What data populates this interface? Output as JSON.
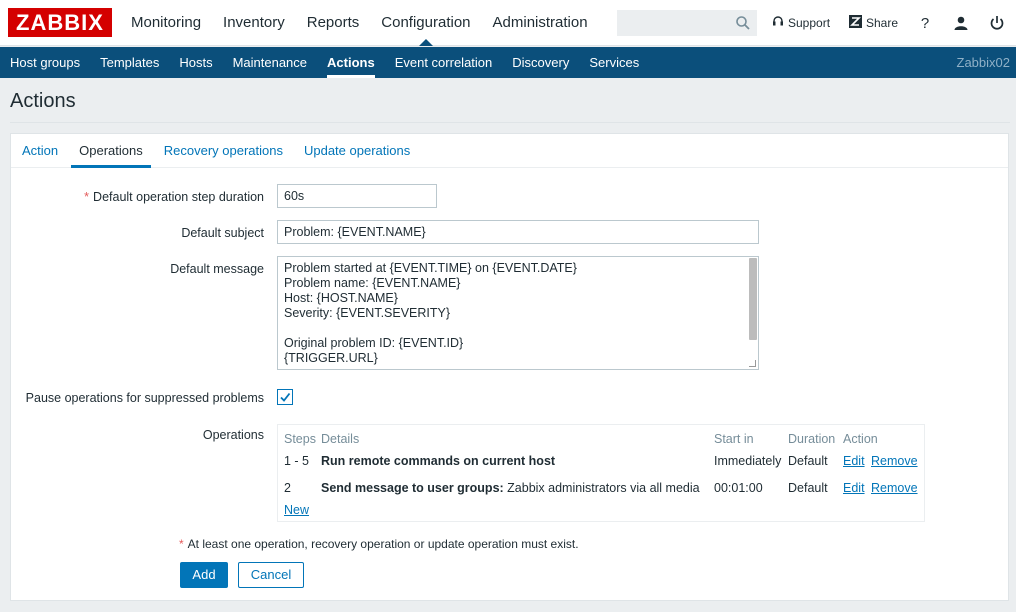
{
  "header": {
    "logo": "ZABBIX",
    "menu": [
      "Monitoring",
      "Inventory",
      "Reports",
      "Configuration",
      "Administration"
    ],
    "selected_menu": "Configuration",
    "search_placeholder": "",
    "search_icon": "magnifier-icon",
    "support_label": "Support",
    "share_label": "Share",
    "help_label": "?",
    "user_icon": "user-icon",
    "logout_icon": "power-icon"
  },
  "submenu": {
    "items": [
      "Host groups",
      "Templates",
      "Hosts",
      "Maintenance",
      "Actions",
      "Event correlation",
      "Discovery",
      "Services"
    ],
    "selected": "Actions",
    "server_name": "Zabbix02"
  },
  "page": {
    "title": "Actions"
  },
  "tabs": [
    "Action",
    "Operations",
    "Recovery operations",
    "Update operations"
  ],
  "active_tab": "Operations",
  "form": {
    "step_duration_label": "Default operation step duration",
    "step_duration_value": "60s",
    "subject_label": "Default subject",
    "subject_value": "Problem: {EVENT.NAME}",
    "message_label": "Default message",
    "message_lines": [
      "Problem started at {EVENT.TIME} on {EVENT.DATE}",
      "Problem name: {EVENT.NAME}",
      "Host: {HOST.NAME}",
      "Severity: {EVENT.SEVERITY}",
      "",
      "Original problem ID: {EVENT.ID}",
      "{TRIGGER.URL}"
    ],
    "pause_label": "Pause operations for suppressed problems",
    "pause_checked": true,
    "operations_label": "Operations"
  },
  "operations_table": {
    "headers": [
      "Steps",
      "Details",
      "Start in",
      "Duration",
      "Action"
    ],
    "rows": [
      {
        "steps": "1 - 5",
        "details_bold": "Run remote commands on current host",
        "details_rest": "",
        "start_in": "Immediately",
        "duration": "Default",
        "edit": "Edit",
        "remove": "Remove"
      },
      {
        "steps": "2",
        "details_bold": "Send message to user groups:",
        "details_rest": " Zabbix administrators via all media",
        "start_in": "00:01:00",
        "duration": "Default",
        "edit": "Edit",
        "remove": "Remove"
      }
    ],
    "new_link": "New"
  },
  "note": "At least one operation, recovery operation or update operation must exist.",
  "buttons": {
    "add": "Add",
    "cancel": "Cancel"
  },
  "colors": {
    "brand": "#d40000",
    "submenu_bg": "#0b4f7b",
    "link": "#0275b8",
    "required": "#e45959"
  }
}
